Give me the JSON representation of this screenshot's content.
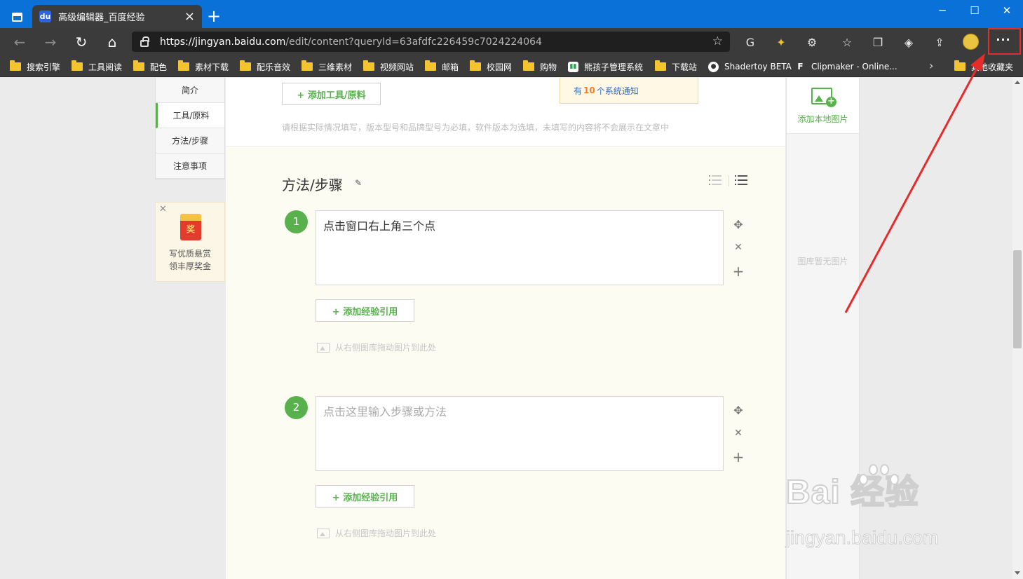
{
  "browser": {
    "tab_title": "高级编辑器_百度经验",
    "tab_favicon": "du",
    "url_host": "https://jingyan.baidu.com",
    "url_path": "/edit/content?queryId=63afdfc226459c7024224064",
    "bookmarks": [
      {
        "label": "搜索引擎",
        "icon": "folder-icon"
      },
      {
        "label": "工具阅读",
        "icon": "folder-icon"
      },
      {
        "label": "配色",
        "icon": "folder-icon"
      },
      {
        "label": "素材下载",
        "icon": "folder-icon"
      },
      {
        "label": "配乐音效",
        "icon": "folder-icon"
      },
      {
        "label": "三维素材",
        "icon": "folder-icon"
      },
      {
        "label": "视频网站",
        "icon": "folder-icon"
      },
      {
        "label": "邮箱",
        "icon": "folder-icon"
      },
      {
        "label": "校园网",
        "icon": "folder-icon"
      },
      {
        "label": "购物",
        "icon": "folder-icon"
      },
      {
        "label": "熊孩子管理系统",
        "icon": "sound-wave-icon"
      },
      {
        "label": "下载站",
        "icon": "folder-icon"
      },
      {
        "label": "Shadertoy BETA",
        "icon": "shadertoy-icon"
      },
      {
        "label": "Clipmaker - Online...",
        "icon": "clipmaker-icon"
      }
    ],
    "other_bookmarks": "其他收藏夹",
    "more_label": "···"
  },
  "sidebar": {
    "items": [
      "简介",
      "工具/原料",
      "方法/步骤",
      "注意事项"
    ],
    "active": "工具/原料"
  },
  "reward": {
    "badge": "奖",
    "line1": "写优质悬赏",
    "line2": "领丰厚奖金"
  },
  "tools": {
    "add_button": "+ 添加工具/原料",
    "hint": "请根据实际情况填写，版本型号和品牌型号为必填，软件版本为选填，未填写的内容将不会展示在文章中"
  },
  "notice": {
    "prefix": "有",
    "count": "10",
    "suffix": "个系统通知"
  },
  "steps_section": {
    "title": "方法/步骤",
    "steps": [
      {
        "num": "1",
        "text": "点击窗口右上角三个点",
        "placeholder": false
      },
      {
        "num": "2",
        "text": "点击这里输入步骤或方法",
        "placeholder": true
      }
    ],
    "add_ref_button": "+ 添加经验引用",
    "drag_hint": "从右侧图库拖动图片到此处"
  },
  "gallery": {
    "add_local": "添加本地图片",
    "empty": "图库暂无图片"
  },
  "watermark": {
    "main": "Bai  经验",
    "sub": "jingyan.baidu.com"
  },
  "colors": {
    "accent_green": "#58b14c",
    "browser_blue": "#0a71d8",
    "annotation_red": "#e62b2b"
  }
}
